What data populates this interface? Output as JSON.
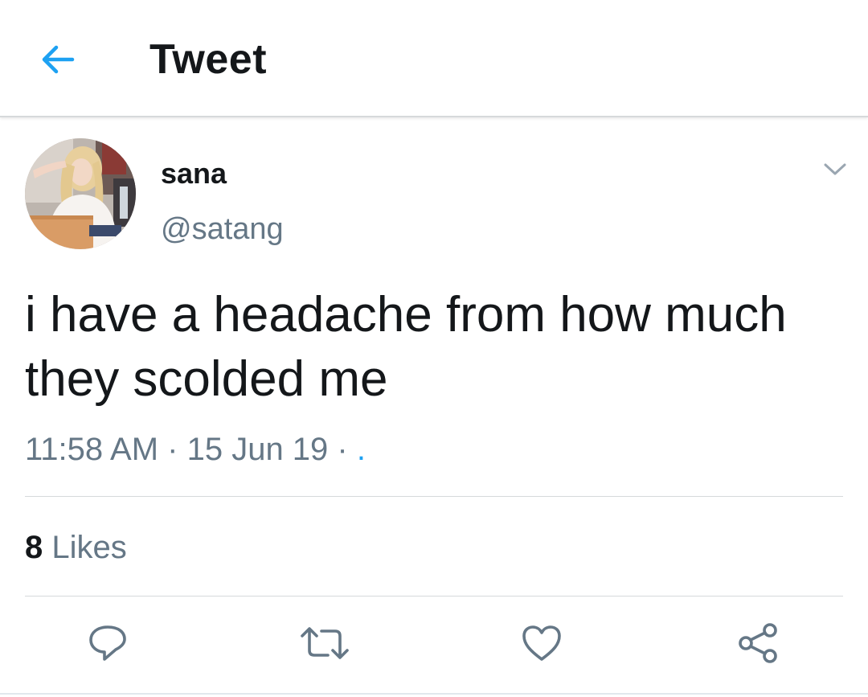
{
  "header": {
    "title": "Tweet",
    "back_icon": "arrow-left-icon",
    "accent_color": "#1da1f2"
  },
  "tweet": {
    "author": {
      "display_name": "sana",
      "handle": "@satang",
      "avatar_icon": "user-avatar-photo"
    },
    "more_icon": "chevron-down-icon",
    "text_line1": "i have a headache from how much",
    "text_line2": "they scolded me",
    "time": "11:58 AM",
    "separator1": " · ",
    "date": "15 Jun 19",
    "separator2": " · ",
    "source": "."
  },
  "stats": {
    "likes_count": "8",
    "likes_label": "Likes"
  },
  "actions": [
    {
      "name": "reply",
      "icon": "reply-icon"
    },
    {
      "name": "retweet",
      "icon": "retweet-icon"
    },
    {
      "name": "like",
      "icon": "heart-icon"
    },
    {
      "name": "share",
      "icon": "share-icon"
    }
  ],
  "colors": {
    "text_primary": "#14171a",
    "text_secondary": "#657786",
    "divider": "#d6d9db",
    "icon_gray": "#657786"
  }
}
